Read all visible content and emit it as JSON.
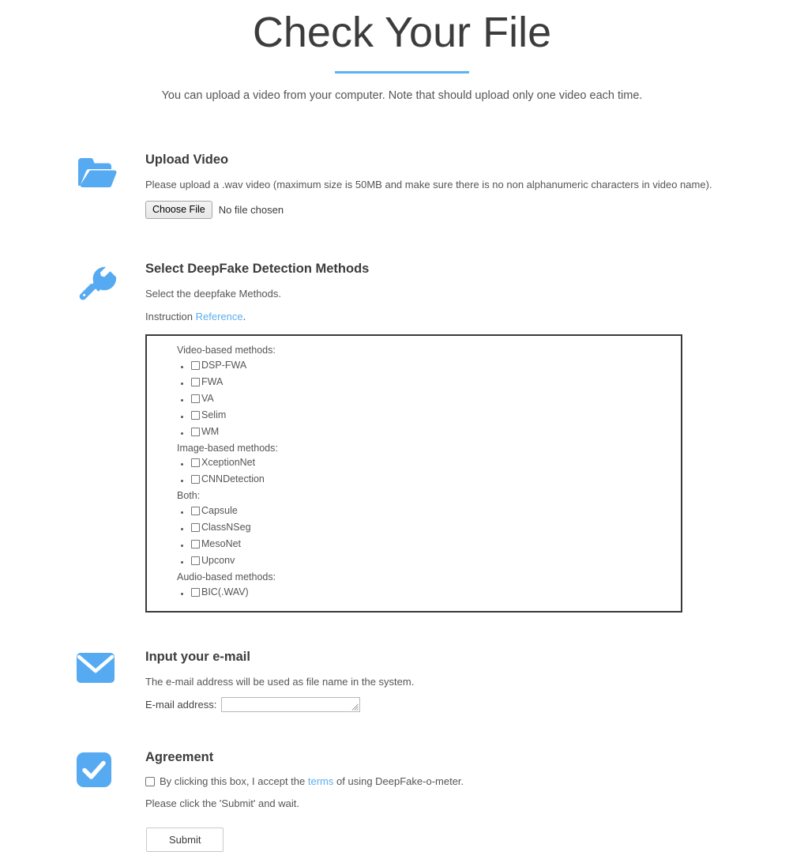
{
  "header": {
    "title": "Check Your File",
    "divider_color": "#5bb3f0",
    "subtitle": "You can upload a video from your computer. Note that should upload only one video each time."
  },
  "sections": {
    "upload": {
      "icon": "folder-open-icon",
      "title": "Upload Video",
      "description": "Please upload a .wav video (maximum size is 50MB and make sure there is no non alphanumeric characters in video name).",
      "choose_file_label": "Choose File",
      "file_status": "No file chosen"
    },
    "methods": {
      "icon": "wrench-icon",
      "title": "Select DeepFake Detection Methods",
      "description": "Select the deepfake Methods.",
      "instruction_prefix": "Instruction",
      "instruction_link": "Reference",
      "instruction_suffix": ".",
      "groups": [
        {
          "label": "Video-based methods:",
          "items": [
            {
              "label": "DSP-FWA",
              "checked": false
            },
            {
              "label": "FWA",
              "checked": false
            },
            {
              "label": "VA",
              "checked": false
            },
            {
              "label": "Selim",
              "checked": false
            },
            {
              "label": "WM",
              "checked": false
            }
          ]
        },
        {
          "label": "Image-based methods:",
          "items": [
            {
              "label": "XceptionNet",
              "checked": false
            },
            {
              "label": "CNNDetection",
              "checked": false
            }
          ]
        },
        {
          "label": "Both:",
          "items": [
            {
              "label": "Capsule",
              "checked": false
            },
            {
              "label": "ClassNSeg",
              "checked": false
            },
            {
              "label": "MesoNet",
              "checked": false
            },
            {
              "label": "Upconv",
              "checked": false
            }
          ]
        },
        {
          "label": "Audio-based methods:",
          "items": [
            {
              "label": "BIC(.WAV)",
              "checked": false
            }
          ]
        }
      ]
    },
    "email": {
      "icon": "envelope-icon",
      "title": "Input your e-mail",
      "description": "The e-mail address will be used as file name in the system.",
      "field_label": "E-mail address:",
      "value": "",
      "placeholder": ""
    },
    "agreement": {
      "icon": "check-square-icon",
      "title": "Agreement",
      "consent_prefix": "By clicking this box, I accept the",
      "consent_link": "terms",
      "consent_suffix": "of using DeepFake-o-meter.",
      "checked": false,
      "submit_note": "Please click the 'Submit' and wait.",
      "submit_label": "Submit"
    }
  },
  "theme": {
    "accent": "#5bb3f0",
    "link": "#5badf0",
    "icon_blue": "#56aaf2",
    "text": "#555555",
    "heading": "#3c3c3c"
  }
}
